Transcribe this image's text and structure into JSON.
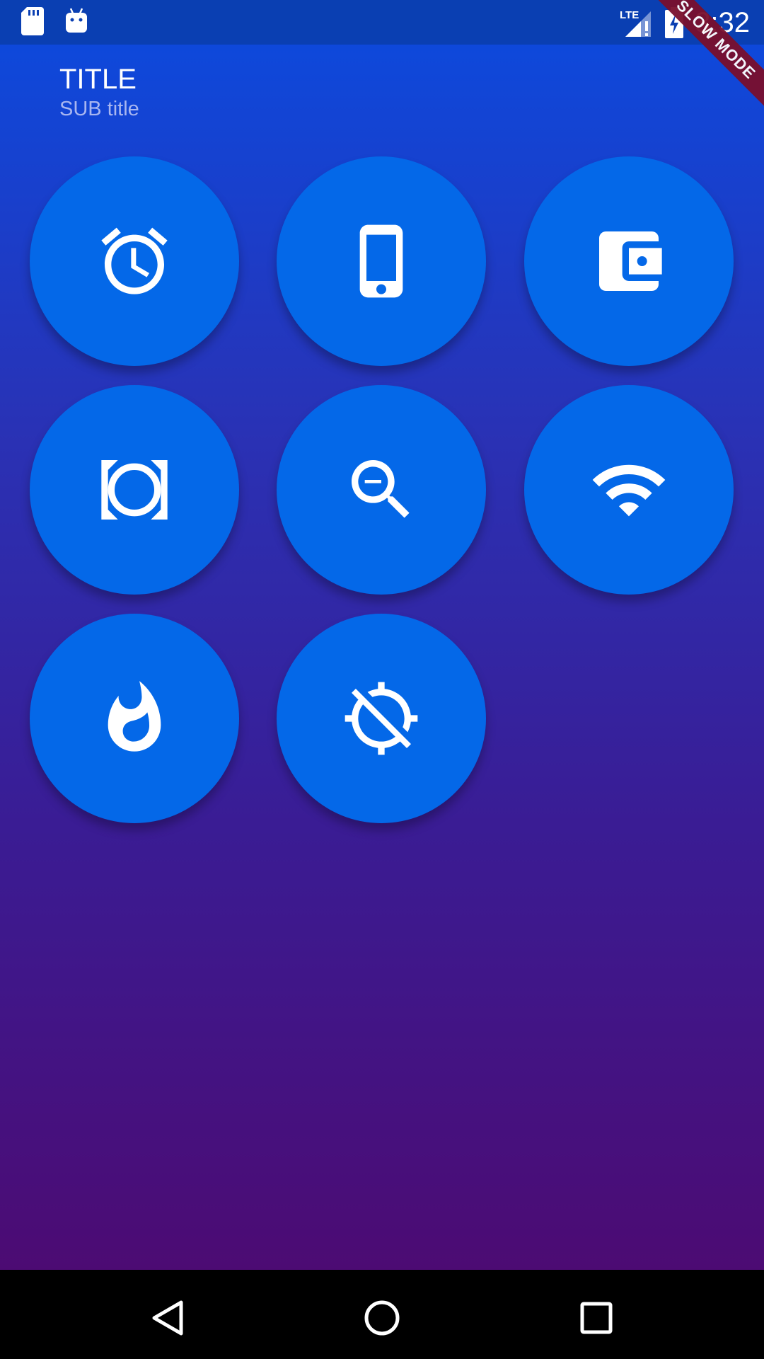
{
  "status_bar": {
    "time": "3:32",
    "left_icons": [
      "sd-card-icon",
      "android-icon"
    ],
    "right_icons": [
      "lte-signal-icon",
      "battery-charging-icon"
    ],
    "network_label": "LTE"
  },
  "debug_banner": {
    "label": "SLOW MODE",
    "color": "#7a0f2d"
  },
  "header": {
    "title": "TITLE",
    "subtitle": "SUB title"
  },
  "buttons": [
    {
      "icon": "alarm-icon"
    },
    {
      "icon": "smartphone-icon"
    },
    {
      "icon": "wallet-icon"
    },
    {
      "icon": "camera-rotate-icon"
    },
    {
      "icon": "zoom-out-icon"
    },
    {
      "icon": "wifi-icon"
    },
    {
      "icon": "fire-icon"
    },
    {
      "icon": "location-disabled-icon"
    }
  ],
  "colors": {
    "button": "#0468e8",
    "gradient_top": "#0b4bdf",
    "gradient_bottom": "#4c0b73",
    "status_bar": "#0a3fb2"
  },
  "nav_bar": {
    "icons": [
      "back-icon",
      "home-icon",
      "recents-icon"
    ]
  }
}
